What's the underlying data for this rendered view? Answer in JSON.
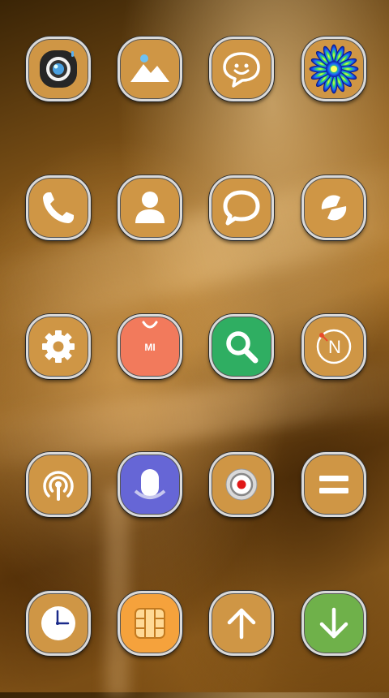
{
  "screen": "home-screen",
  "colors": {
    "icon_base": "#cf9645",
    "icon_rim": "#d9d9d9",
    "mi_store": "#f27a5c",
    "search": "#2fae62",
    "voice": "#6666d6",
    "sim": "#f5a23c",
    "download": "#6fb14a"
  },
  "apps": [
    {
      "icon": "camera-icon"
    },
    {
      "icon": "gallery-icon"
    },
    {
      "icon": "messages-icon"
    },
    {
      "icon": "themes-icon"
    },
    {
      "icon": "phone-icon"
    },
    {
      "icon": "contacts-icon"
    },
    {
      "icon": "chat-bubble-icon"
    },
    {
      "icon": "sync-icon"
    },
    {
      "icon": "settings-icon"
    },
    {
      "icon": "mi-store-icon",
      "label": "MI"
    },
    {
      "icon": "search-icon"
    },
    {
      "icon": "compass-icon",
      "label": "N"
    },
    {
      "icon": "wireless-icon"
    },
    {
      "icon": "voice-recorder-icon"
    },
    {
      "icon": "screen-recorder-icon"
    },
    {
      "icon": "calculator-icon"
    },
    {
      "icon": "clock-icon"
    },
    {
      "icon": "sim-toolkit-icon"
    },
    {
      "icon": "updater-icon"
    },
    {
      "icon": "downloads-icon"
    }
  ]
}
